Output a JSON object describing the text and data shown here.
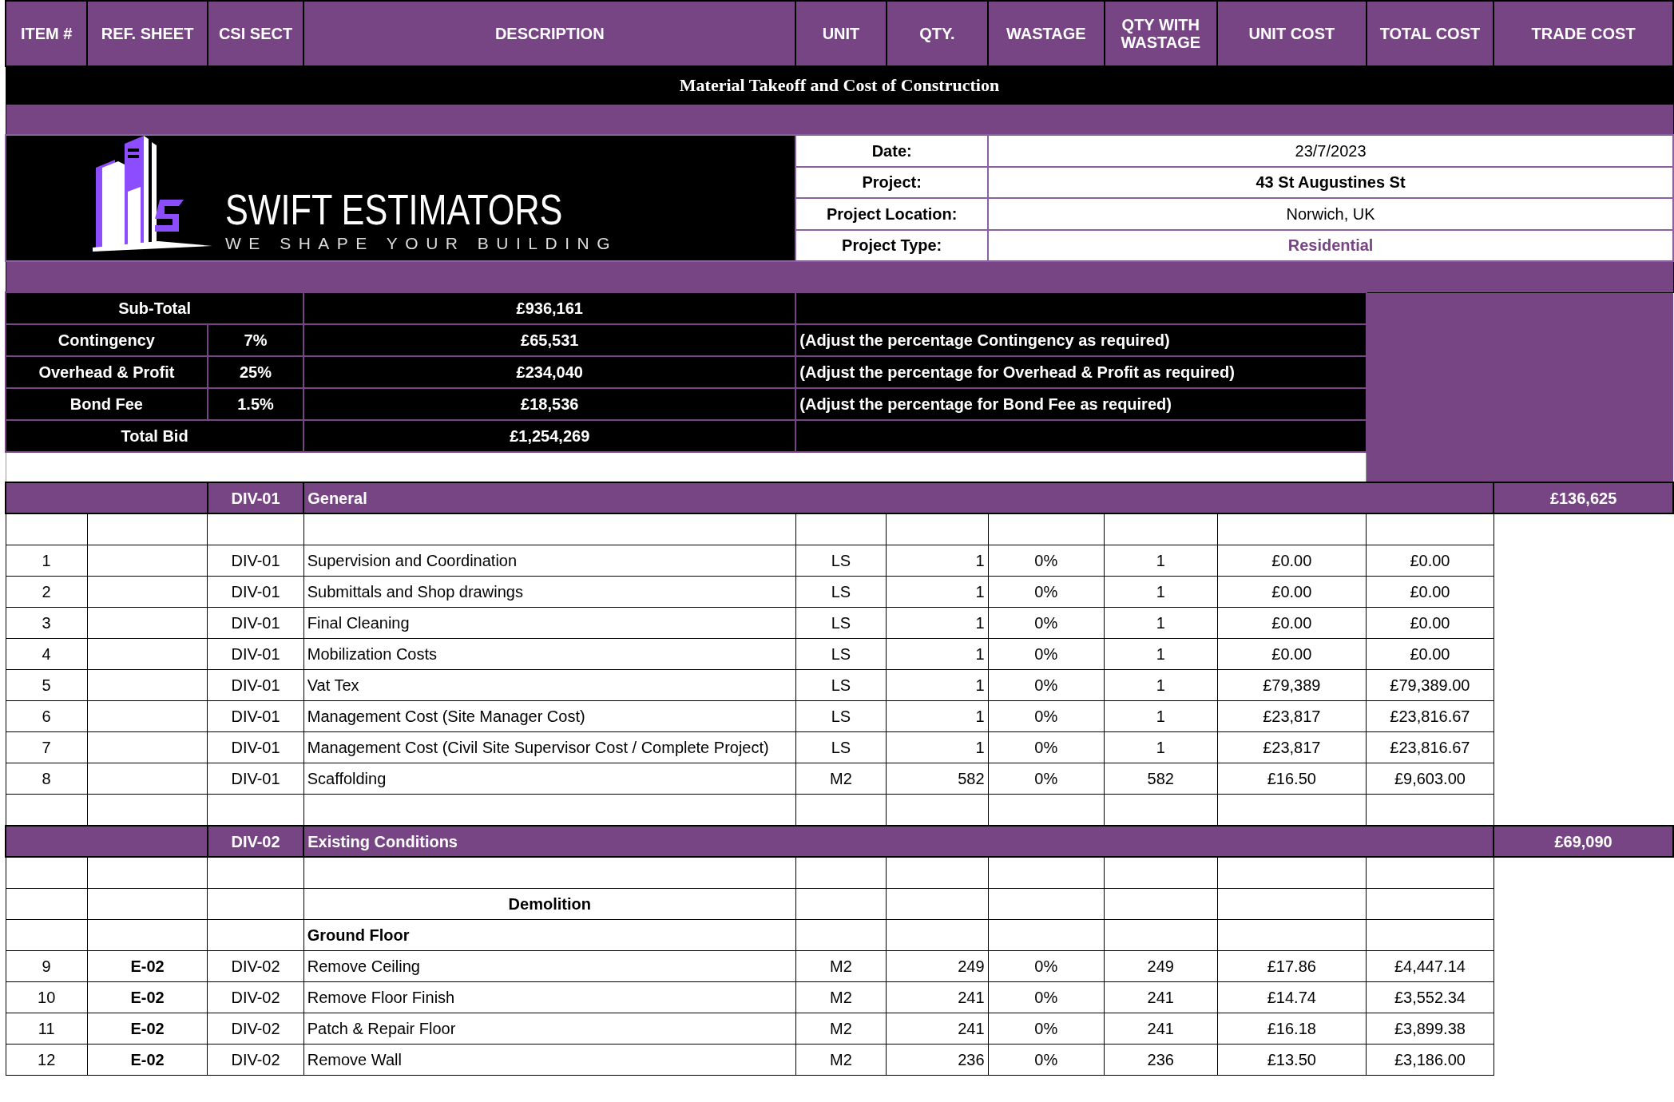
{
  "columns": [
    "ITEM #",
    "REF. SHEET",
    "CSI SECT",
    "DESCRIPTION",
    "UNIT",
    "QTY.",
    "WASTAGE",
    "QTY WITH WASTAGE",
    "UNIT COST",
    "TOTAL COST",
    "TRADE COST"
  ],
  "title": "Material Takeoff and Cost of Construction",
  "logo": {
    "name": "SWIFT ESTIMATORS",
    "tagline": "WE SHAPE YOUR BUILDING"
  },
  "project_info": [
    {
      "label": "Date:",
      "value": "23/7/2023",
      "kind": "plain"
    },
    {
      "label": "Project:",
      "value": "43 St Augustines St",
      "kind": "bold"
    },
    {
      "label": "Project Location:",
      "value": "Norwich, UK",
      "kind": "plain"
    },
    {
      "label": "Project Type:",
      "value": "Residential",
      "kind": "accent"
    }
  ],
  "summary": [
    {
      "label": "Sub-Total",
      "amount": "£936,161"
    },
    {
      "label": "Contingency",
      "percent": "7%",
      "amount": "£65,531",
      "note": "(Adjust the percentage Contingency as required)"
    },
    {
      "label": "Overhead & Profit",
      "percent": "25%",
      "amount": "£234,040",
      "note": "(Adjust the percentage for Overhead & Profit as required)"
    },
    {
      "label": "Bond Fee",
      "percent": "1.5%",
      "amount": "£18,536",
      "note": "(Adjust the percentage for Bond Fee as required)"
    },
    {
      "label": "Total Bid",
      "amount": "£1,254,269"
    }
  ],
  "sections": [
    {
      "code": "DIV-01",
      "title": "General",
      "trade_cost": "£136,625",
      "rows": [
        {
          "kind": "blank"
        },
        {
          "kind": "item",
          "item": "1",
          "ref": "",
          "csi": "DIV-01",
          "description": "Supervision and Coordination",
          "unit": "LS",
          "qty": "1",
          "wastage": "0%",
          "qty_with_wastage": "1",
          "unit_cost": "£0.00",
          "total_cost": "£0.00"
        },
        {
          "kind": "item",
          "item": "2",
          "ref": "",
          "csi": "DIV-01",
          "description": "Submittals and Shop drawings",
          "unit": "LS",
          "qty": "1",
          "wastage": "0%",
          "qty_with_wastage": "1",
          "unit_cost": "£0.00",
          "total_cost": "£0.00"
        },
        {
          "kind": "item",
          "item": "3",
          "ref": "",
          "csi": "DIV-01",
          "description": "Final Cleaning",
          "unit": "LS",
          "qty": "1",
          "wastage": "0%",
          "qty_with_wastage": "1",
          "unit_cost": "£0.00",
          "total_cost": "£0.00"
        },
        {
          "kind": "item",
          "item": "4",
          "ref": "",
          "csi": "DIV-01",
          "description": "Mobilization Costs",
          "unit": "LS",
          "qty": "1",
          "wastage": "0%",
          "qty_with_wastage": "1",
          "unit_cost": "£0.00",
          "total_cost": "£0.00"
        },
        {
          "kind": "item",
          "item": "5",
          "ref": "",
          "csi": "DIV-01",
          "description": "Vat Tex",
          "unit": "LS",
          "qty": "1",
          "wastage": "0%",
          "qty_with_wastage": "1",
          "unit_cost": "£79,389",
          "total_cost": "£79,389.00"
        },
        {
          "kind": "item",
          "item": "6",
          "ref": "",
          "csi": "DIV-01",
          "description": "Management Cost (Site Manager Cost)",
          "unit": "LS",
          "qty": "1",
          "wastage": "0%",
          "qty_with_wastage": "1",
          "unit_cost": "£23,817",
          "total_cost": "£23,816.67"
        },
        {
          "kind": "item",
          "item": "7",
          "ref": "",
          "csi": "DIV-01",
          "description": "Management Cost (Civil Site Supervisor Cost / Complete Project)",
          "unit": "LS",
          "qty": "1",
          "wastage": "0%",
          "qty_with_wastage": "1",
          "unit_cost": "£23,817",
          "total_cost": "£23,816.67"
        },
        {
          "kind": "item",
          "item": "8",
          "ref": "",
          "csi": "DIV-01",
          "description": "Scaffolding",
          "unit": "M2",
          "qty": "582",
          "wastage": "0%",
          "qty_with_wastage": "582",
          "unit_cost": "£16.50",
          "total_cost": "£9,603.00"
        },
        {
          "kind": "blank"
        }
      ]
    },
    {
      "code": "DIV-02",
      "title": "Existing Conditions",
      "trade_cost": "£69,090",
      "rows": [
        {
          "kind": "blank"
        },
        {
          "kind": "heading",
          "text": "Demolition"
        },
        {
          "kind": "subheading",
          "text": "Ground Floor"
        },
        {
          "kind": "item",
          "item": "9",
          "ref": "E-02",
          "csi": "DIV-02",
          "description": "Remove Ceiling",
          "unit": "M2",
          "qty": "249",
          "wastage": "0%",
          "qty_with_wastage": "249",
          "unit_cost": "£17.86",
          "total_cost": "£4,447.14"
        },
        {
          "kind": "item",
          "item": "10",
          "ref": "E-02",
          "csi": "DIV-02",
          "description": "Remove Floor Finish",
          "unit": "M2",
          "qty": "241",
          "wastage": "0%",
          "qty_with_wastage": "241",
          "unit_cost": "£14.74",
          "total_cost": "£3,552.34"
        },
        {
          "kind": "item",
          "item": "11",
          "ref": "E-02",
          "csi": "DIV-02",
          "description": "Patch & Repair Floor",
          "unit": "M2",
          "qty": "241",
          "wastage": "0%",
          "qty_with_wastage": "241",
          "unit_cost": "£16.18",
          "total_cost": "£3,899.38"
        },
        {
          "kind": "item",
          "item": "12",
          "ref": "E-02",
          "csi": "DIV-02",
          "description": "Remove Wall",
          "unit": "M2",
          "qty": "236",
          "wastage": "0%",
          "qty_with_wastage": "236",
          "unit_cost": "£13.50",
          "total_cost": "£3,186.00"
        }
      ]
    }
  ]
}
